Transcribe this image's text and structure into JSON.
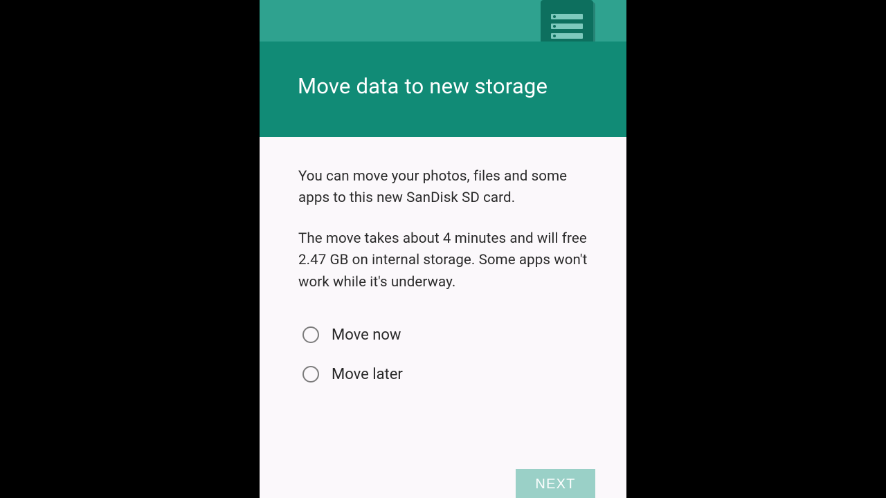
{
  "header": {
    "title": "Move data to new storage",
    "icon_name": "storage-server-icon"
  },
  "body": {
    "paragraph1": "You can move your photos, files and some apps to this new SanDisk SD card.",
    "paragraph2": "The move takes about 4 minutes and will free 2.47 GB on internal storage. Some apps won't work while it's underway."
  },
  "options": [
    {
      "label": "Move now",
      "selected": false
    },
    {
      "label": "Move later",
      "selected": false
    }
  ],
  "footer": {
    "next_label": "NEXT"
  },
  "colors": {
    "header_top": "#2fa28f",
    "header_main": "#118b76",
    "icon_bg": "#0d6f5e",
    "next_bg": "#9ad0c7"
  }
}
